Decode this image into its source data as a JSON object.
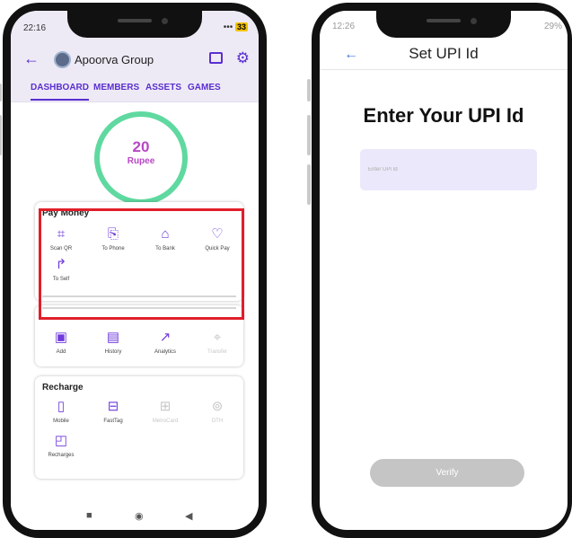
{
  "left_phone": {
    "status": {
      "time": "22:16",
      "signal_text": "•••",
      "battery": "33"
    },
    "appbar": {
      "back_icon": "back-arrow-icon",
      "title": "Apoorva Group"
    },
    "tabs": [
      {
        "label": "DASHBOARD",
        "active": true
      },
      {
        "label": "MEMBERS"
      },
      {
        "label": "ASSETS"
      },
      {
        "label": "GAMES"
      }
    ],
    "balance": {
      "amount": "20",
      "unit": "Rupee"
    },
    "pay_money": {
      "title": "Pay Money",
      "items": [
        {
          "label": "Scan QR",
          "icon": "qr-scan-icon"
        },
        {
          "label": "To Phone",
          "icon": "phone-transfer-icon"
        },
        {
          "label": "To Bank",
          "icon": "bank-icon"
        },
        {
          "label": "Quick Pay",
          "icon": "heart-icon"
        },
        {
          "label": "To Self",
          "icon": "u-turn-icon"
        }
      ]
    },
    "wallet": {
      "items": [
        {
          "label": "Add",
          "icon": "wallet-icon"
        },
        {
          "label": "History",
          "icon": "history-icon"
        },
        {
          "label": "Analytics",
          "icon": "analytics-icon"
        },
        {
          "label": "Transfer",
          "icon": "transfer-icon",
          "disabled": true
        }
      ]
    },
    "recharge": {
      "title": "Recharge",
      "items": [
        {
          "label": "Mobile",
          "icon": "mobile-icon"
        },
        {
          "label": "FastTag",
          "icon": "car-icon"
        },
        {
          "label": "MetroCard",
          "icon": "metro-icon",
          "disabled": true
        },
        {
          "label": "DTH",
          "icon": "antenna-icon",
          "disabled": true
        },
        {
          "label": "Recharges",
          "icon": "recharges-icon"
        }
      ]
    },
    "highlight_color": "#e01e2a"
  },
  "right_phone": {
    "status": {
      "time": "12:26",
      "right_text": "29%"
    },
    "appbar": {
      "title": "Set UPI Id"
    },
    "heading": "Enter Your UPI Id",
    "input_placeholder": "Enter UPI Id",
    "verify_label": "Verify"
  },
  "colors": {
    "accent": "#5a2fd0",
    "ring": "#5fd9a0",
    "amount": "#b847c5",
    "input_bg": "#ece8fb",
    "button_disabled": "#c5c5c5"
  }
}
